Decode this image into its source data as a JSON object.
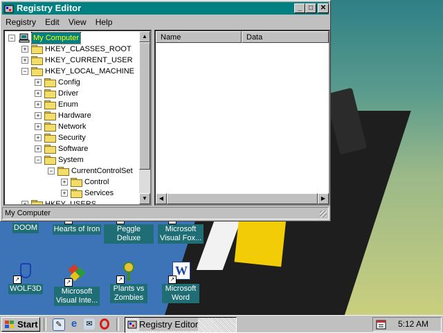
{
  "window": {
    "title": "Registry Editor",
    "menu": [
      "Registry",
      "Edit",
      "View",
      "Help"
    ],
    "status": "My Computer",
    "columns": [
      "Name",
      "Data"
    ]
  },
  "tree": {
    "nodes": [
      {
        "label": "My Computer",
        "expander": "−"
      },
      {
        "label": "HKEY_CLASSES_ROOT",
        "expander": "+"
      },
      {
        "label": "HKEY_CURRENT_USER",
        "expander": "+"
      },
      {
        "label": "HKEY_LOCAL_MACHINE",
        "expander": "−"
      },
      {
        "label": "Config",
        "expander": "+"
      },
      {
        "label": "Driver",
        "expander": "+"
      },
      {
        "label": "Enum",
        "expander": "+"
      },
      {
        "label": "Hardware",
        "expander": "+"
      },
      {
        "label": "Network",
        "expander": "+"
      },
      {
        "label": "Security",
        "expander": "+"
      },
      {
        "label": "Software",
        "expander": "+"
      },
      {
        "label": "System",
        "expander": "−"
      },
      {
        "label": "CurrentControlSet",
        "expander": "−"
      },
      {
        "label": "Control",
        "expander": "+"
      },
      {
        "label": "Services",
        "expander": "+"
      },
      {
        "label": "HKEY_USERS",
        "expander": "+"
      }
    ]
  },
  "desktop": {
    "icons": [
      {
        "label": "DOOM"
      },
      {
        "label": "Hearts of Iron"
      },
      {
        "label": "Peggle Deluxe"
      },
      {
        "label": "Microsoft Visual Fox..."
      },
      {
        "label": "WOLF3D"
      },
      {
        "label": "Microsoft Visual Inte..."
      },
      {
        "label": "Plants vs Zombies"
      },
      {
        "label": "Microsoft Word"
      }
    ]
  },
  "taskbar": {
    "start_label": "Start",
    "task_label": "Registry Editor",
    "clock": "5:12 AM"
  },
  "colors": {
    "titlebar": "#008080",
    "chrome": "#c0c0c0",
    "selection": "#008080"
  }
}
